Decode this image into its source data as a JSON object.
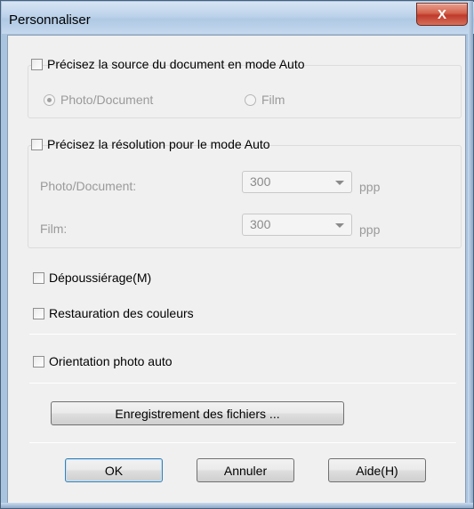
{
  "window": {
    "title": "Personnaliser",
    "close_label": "X"
  },
  "source_group": {
    "checkbox_label": "Précisez la source du document en mode Auto",
    "checked": false,
    "options": [
      {
        "label": "Photo/Document",
        "selected": true
      },
      {
        "label": "Film",
        "selected": false
      }
    ]
  },
  "resolution_group": {
    "checkbox_label": "Précisez la résolution pour le mode Auto",
    "checked": false,
    "rows": [
      {
        "label": "Photo/Document:",
        "value": "300",
        "unit": "ppp"
      },
      {
        "label": "Film:",
        "value": "300",
        "unit": "ppp"
      }
    ]
  },
  "options": {
    "dust": {
      "label": "Dépoussiérage(M)",
      "checked": false
    },
    "color_restore": {
      "label": "Restauration des couleurs",
      "checked": false
    },
    "auto_orient": {
      "label": "Orientation photo auto",
      "checked": false
    }
  },
  "file_save_button": "Enregistrement des fichiers ...",
  "footer": {
    "ok": "OK",
    "cancel": "Annuler",
    "help": "Aide(H)"
  },
  "colors": {
    "close_button": "#c0392b",
    "dialog_bg": "#f0f0f0",
    "disabled_text": "#9a9a9a",
    "default_button_border": "#3c7fb1"
  }
}
